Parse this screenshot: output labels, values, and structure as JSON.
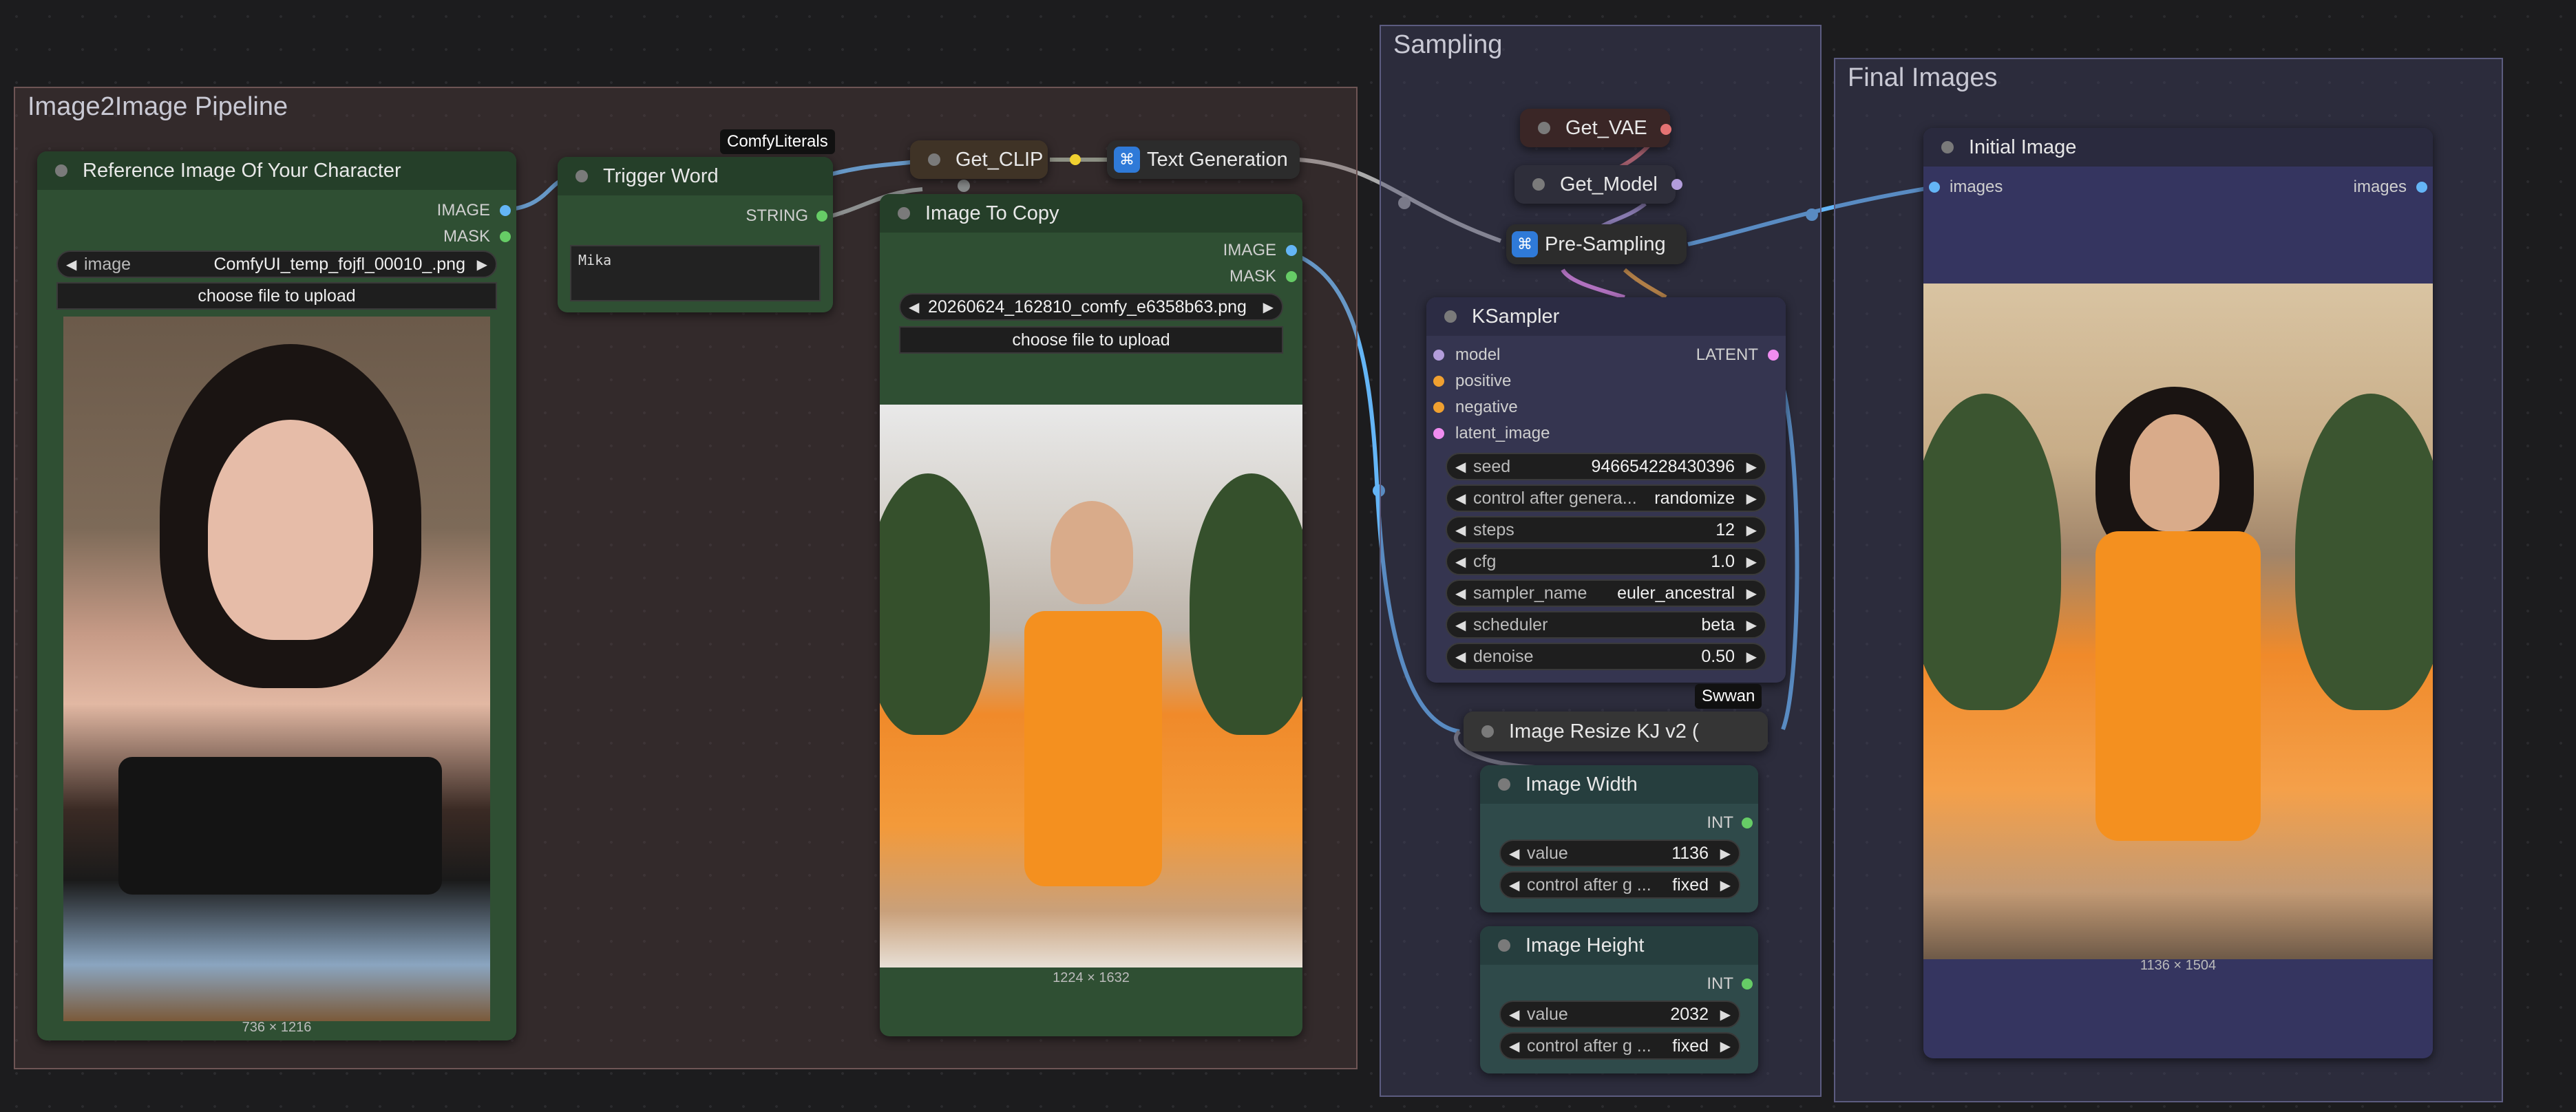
{
  "groups": {
    "img2img": {
      "title": "Image2Image Pipeline"
    },
    "sampling": {
      "title": "Sampling"
    },
    "final": {
      "title": "Final Images"
    }
  },
  "badges": {
    "comfy_literals": "ComfyLiterals",
    "swwan": "Swwan"
  },
  "reference_node": {
    "title": "Reference Image Of Your Character",
    "out_image": "IMAGE",
    "out_mask": "MASK",
    "image_label": "image",
    "image_value": "ComfyUI_temp_fojfl_00010_.png",
    "upload_label": "choose file to upload",
    "size": "736 × 1216"
  },
  "trigger_node": {
    "title": "Trigger Word",
    "out_string": "STRING",
    "text": "Mika"
  },
  "get_clip": {
    "title": "Get_CLIP"
  },
  "text_generation": {
    "title": "Text Generation"
  },
  "copy_node": {
    "title": "Image To Copy",
    "out_image": "IMAGE",
    "out_mask": "MASK",
    "image_value": "20260624_162810_comfy_e6358b63.png",
    "upload_label": "choose file to upload",
    "size": "1224 × 1632"
  },
  "get_vae": {
    "title": "Get_VAE"
  },
  "get_model": {
    "title": "Get_Model"
  },
  "pre_sampling": {
    "title": "Pre-Sampling"
  },
  "ksampler": {
    "title": "KSampler",
    "inputs": [
      "model",
      "positive",
      "negative",
      "latent_image"
    ],
    "input_colors": [
      "#b39ddb",
      "#f0a030",
      "#f0a030",
      "#f08cf0"
    ],
    "output": "LATENT",
    "widgets": [
      {
        "label": "seed",
        "value": "946654228430396"
      },
      {
        "label": "control after genera...",
        "value": "randomize"
      },
      {
        "label": "steps",
        "value": "12"
      },
      {
        "label": "cfg",
        "value": "1.0"
      },
      {
        "label": "sampler_name",
        "value": "euler_ancestral"
      },
      {
        "label": "scheduler",
        "value": "beta"
      },
      {
        "label": "denoise",
        "value": "0.50"
      }
    ]
  },
  "resize_node": {
    "title": "Image Resize KJ v2 ("
  },
  "width_node": {
    "title": "Image Width",
    "out": "INT",
    "value_label": "value",
    "value": "1136",
    "control_label": "control after g ...",
    "control_value": "fixed"
  },
  "height_node": {
    "title": "Image Height",
    "out": "INT",
    "value_label": "value",
    "value": "2032",
    "control_label": "control after g ...",
    "control_value": "fixed"
  },
  "initial_image": {
    "title": "Initial Image",
    "in": "images",
    "out": "images",
    "size": "1136 × 1504"
  },
  "colors": {
    "image_socket": "#64b5f6",
    "string_socket": "#66cc66",
    "int_socket": "#66cc66",
    "latent_socket": "#f08cf0"
  }
}
